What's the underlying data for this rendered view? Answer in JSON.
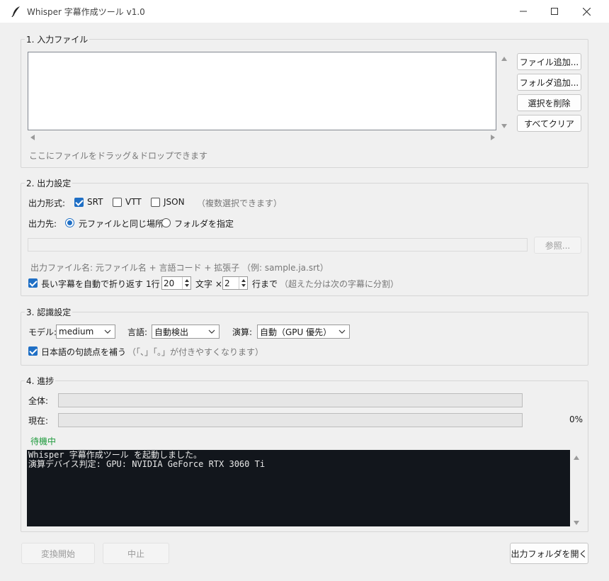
{
  "window": {
    "title": "Whisper 字幕作成ツール  v1.0"
  },
  "input": {
    "legend": "1. 入力ファイル",
    "buttons": {
      "add_files": "ファイル追加...",
      "add_folder": "フォルダ追加...",
      "remove_selected": "選択を削除",
      "clear_all": "すべてクリア"
    },
    "drop_hint": "ここにファイルをドラッグ＆ドロップできます"
  },
  "output": {
    "legend": "2. 出力設定",
    "format_label": "出力形式:",
    "formats": [
      {
        "label": "SRT",
        "checked": true
      },
      {
        "label": "VTT",
        "checked": false
      },
      {
        "label": "JSON",
        "checked": false
      }
    ],
    "format_note": "（複数選択できます）",
    "dest_label": "出力先:",
    "dest_options": [
      {
        "label": "元ファイルと同じ場所",
        "selected": true
      },
      {
        "label": "フォルダを指定",
        "selected": false
      }
    ],
    "browse_label": "参照...",
    "path_value": "",
    "filename_note": "出力ファイル名: 元ファイル名 + 言語コード + 拡張子  （例: sample.ja.srt）",
    "wrap": {
      "label": "長い字幕を自動で折り返す",
      "checked": true,
      "prefix": "1行",
      "chars_value": "20",
      "chars_unit": "文字 ×",
      "lines_value": "2",
      "lines_unit": "行まで",
      "note": "（超えた分は次の字幕に分割）"
    }
  },
  "recognition": {
    "legend": "3. 認識設定",
    "model_label": "モデル:",
    "model_value": "medium",
    "language_label": "言語:",
    "language_value": "自動検出",
    "compute_label": "演算:",
    "compute_value": "自動（GPU 優先）",
    "punct_label": "日本語の句読点を補う",
    "punct_checked": true,
    "punct_note": "（「、」「。」が付きやすくなります）"
  },
  "progress": {
    "legend": "4. 進捗",
    "overall_label": "全体:",
    "current_label": "現在:",
    "overall_fraction": 0,
    "current_fraction": 0,
    "percent_text": "0%",
    "status": "待機中",
    "status_color": "#1e9a3c",
    "log": "Whisper 字幕作成ツール を起動しました。\n演算デバイス判定: GPU: NVIDIA GeForce RTX 3060 Ti"
  },
  "footer": {
    "start": "変換開始",
    "stop": "中止",
    "open_output": "出力フォルダを開く"
  },
  "colors": {
    "accent": "#1f6fc5",
    "log_bg": "#12161c"
  }
}
